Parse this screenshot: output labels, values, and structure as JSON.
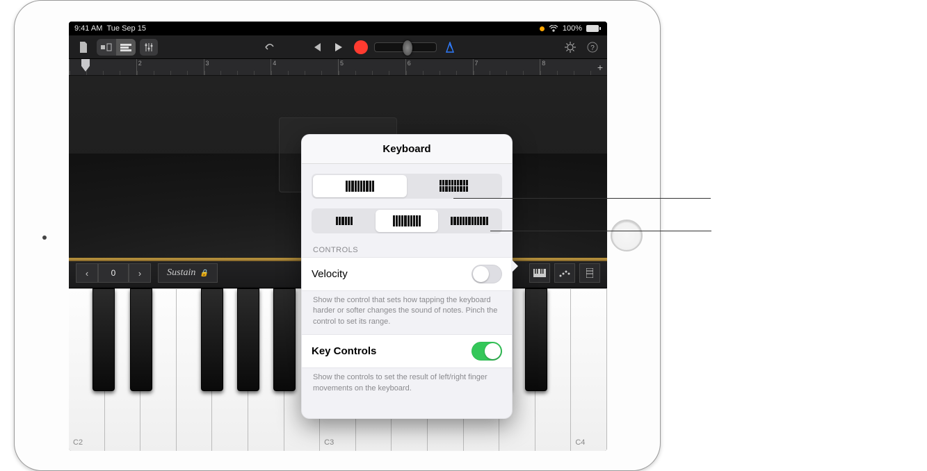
{
  "statusbar": {
    "time": "9:41 AM",
    "date": "Tue Sep 15",
    "battery": "100%"
  },
  "ruler": {
    "marks": [
      "2",
      "3",
      "4",
      "5",
      "6",
      "7",
      "8"
    ]
  },
  "controls": {
    "octave": "0",
    "sustain": "Sustain"
  },
  "keyboard": {
    "labels": [
      "C2",
      "C3",
      "C4"
    ]
  },
  "popover": {
    "title": "Keyboard",
    "section": "CONTROLS",
    "velocity": {
      "label": "Velocity",
      "on": false,
      "desc": "Show the control that sets how tapping the keyboard harder or softer changes the sound of notes. Pinch the control to set its range."
    },
    "keycontrols": {
      "label": "Key Controls",
      "on": true,
      "desc": "Show the controls to set the result of left/right finger movements on the keyboard."
    }
  }
}
